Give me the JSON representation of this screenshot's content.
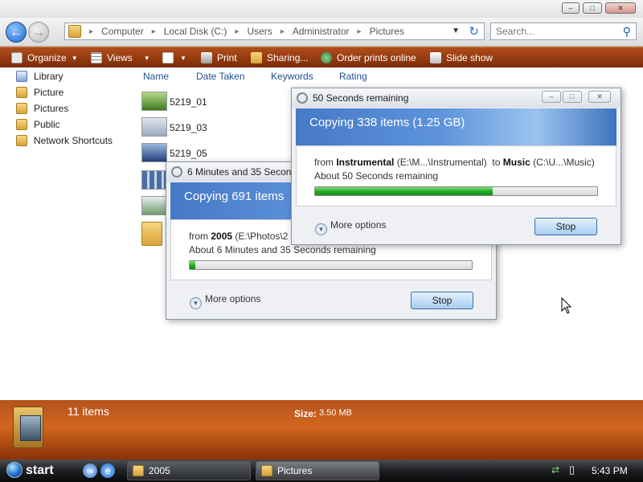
{
  "address_bar": {
    "crumbs": [
      "Computer",
      "Local Disk (C:)",
      "Users",
      "Administrator",
      "Pictures"
    ],
    "search_placeholder": "Search..."
  },
  "command_bar": {
    "items": [
      "Organize",
      "Views",
      "",
      "Print",
      "Sharing...",
      "Order prints online",
      "Slide show"
    ]
  },
  "nav_pane": {
    "items": [
      "Library",
      "Picture",
      "Pictures",
      "Public",
      "Network Shortcuts"
    ]
  },
  "file_list": {
    "columns": [
      "Name",
      "Date Taken",
      "Keywords",
      "Rating"
    ],
    "files": [
      "5219_01",
      "5219_03",
      "5219_05"
    ]
  },
  "details_pane": {
    "items_count": "11 items",
    "size_label": "Size:",
    "size_value": "3.50 MB"
  },
  "dialog_front": {
    "title": "50 Seconds remaining",
    "header": "Copying 338 items (1.25 GB)",
    "from_word": "from",
    "source_name": "Instrumental",
    "source_path": "(E:\\M...\\Instrumental)",
    "to_word": "to",
    "dest_name": "Music",
    "dest_path": "(C:\\U...\\Music)",
    "remaining": "About 50 Seconds remaining",
    "progress": 0.63,
    "more_options": "More options",
    "stop": "Stop"
  },
  "dialog_back": {
    "title": "6 Minutes and 35 Seconds remaining",
    "header": "Copying 691 items",
    "from_word": "from",
    "source_name": "2005",
    "source_path": "(E:\\Photos\\2",
    "remaining": "About 6 Minutes and 35 Seconds remaining",
    "progress": 0.02,
    "more_options": "More options",
    "stop": "Stop"
  },
  "taskbar": {
    "start": "start",
    "tasks": [
      "2005",
      "Pictures"
    ],
    "clock": "5:43 PM"
  },
  "colors": {
    "accent_orange": "#b24d1b",
    "progress_green": "#22a91f",
    "dialog_header_blue": "#4679c6"
  }
}
